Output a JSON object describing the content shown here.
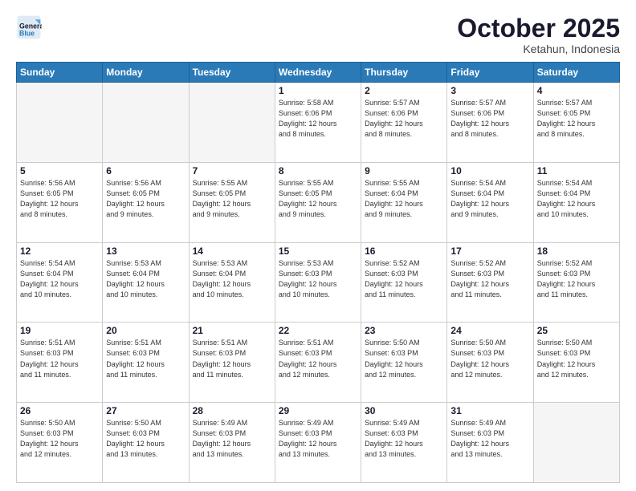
{
  "header": {
    "logo_line1": "General",
    "logo_line2": "Blue",
    "month": "October 2025",
    "location": "Ketahun, Indonesia"
  },
  "weekdays": [
    "Sunday",
    "Monday",
    "Tuesday",
    "Wednesday",
    "Thursday",
    "Friday",
    "Saturday"
  ],
  "weeks": [
    [
      {
        "day": "",
        "info": ""
      },
      {
        "day": "",
        "info": ""
      },
      {
        "day": "",
        "info": ""
      },
      {
        "day": "1",
        "info": "Sunrise: 5:58 AM\nSunset: 6:06 PM\nDaylight: 12 hours\nand 8 minutes."
      },
      {
        "day": "2",
        "info": "Sunrise: 5:57 AM\nSunset: 6:06 PM\nDaylight: 12 hours\nand 8 minutes."
      },
      {
        "day": "3",
        "info": "Sunrise: 5:57 AM\nSunset: 6:06 PM\nDaylight: 12 hours\nand 8 minutes."
      },
      {
        "day": "4",
        "info": "Sunrise: 5:57 AM\nSunset: 6:05 PM\nDaylight: 12 hours\nand 8 minutes."
      }
    ],
    [
      {
        "day": "5",
        "info": "Sunrise: 5:56 AM\nSunset: 6:05 PM\nDaylight: 12 hours\nand 8 minutes."
      },
      {
        "day": "6",
        "info": "Sunrise: 5:56 AM\nSunset: 6:05 PM\nDaylight: 12 hours\nand 9 minutes."
      },
      {
        "day": "7",
        "info": "Sunrise: 5:55 AM\nSunset: 6:05 PM\nDaylight: 12 hours\nand 9 minutes."
      },
      {
        "day": "8",
        "info": "Sunrise: 5:55 AM\nSunset: 6:05 PM\nDaylight: 12 hours\nand 9 minutes."
      },
      {
        "day": "9",
        "info": "Sunrise: 5:55 AM\nSunset: 6:04 PM\nDaylight: 12 hours\nand 9 minutes."
      },
      {
        "day": "10",
        "info": "Sunrise: 5:54 AM\nSunset: 6:04 PM\nDaylight: 12 hours\nand 9 minutes."
      },
      {
        "day": "11",
        "info": "Sunrise: 5:54 AM\nSunset: 6:04 PM\nDaylight: 12 hours\nand 10 minutes."
      }
    ],
    [
      {
        "day": "12",
        "info": "Sunrise: 5:54 AM\nSunset: 6:04 PM\nDaylight: 12 hours\nand 10 minutes."
      },
      {
        "day": "13",
        "info": "Sunrise: 5:53 AM\nSunset: 6:04 PM\nDaylight: 12 hours\nand 10 minutes."
      },
      {
        "day": "14",
        "info": "Sunrise: 5:53 AM\nSunset: 6:04 PM\nDaylight: 12 hours\nand 10 minutes."
      },
      {
        "day": "15",
        "info": "Sunrise: 5:53 AM\nSunset: 6:03 PM\nDaylight: 12 hours\nand 10 minutes."
      },
      {
        "day": "16",
        "info": "Sunrise: 5:52 AM\nSunset: 6:03 PM\nDaylight: 12 hours\nand 11 minutes."
      },
      {
        "day": "17",
        "info": "Sunrise: 5:52 AM\nSunset: 6:03 PM\nDaylight: 12 hours\nand 11 minutes."
      },
      {
        "day": "18",
        "info": "Sunrise: 5:52 AM\nSunset: 6:03 PM\nDaylight: 12 hours\nand 11 minutes."
      }
    ],
    [
      {
        "day": "19",
        "info": "Sunrise: 5:51 AM\nSunset: 6:03 PM\nDaylight: 12 hours\nand 11 minutes."
      },
      {
        "day": "20",
        "info": "Sunrise: 5:51 AM\nSunset: 6:03 PM\nDaylight: 12 hours\nand 11 minutes."
      },
      {
        "day": "21",
        "info": "Sunrise: 5:51 AM\nSunset: 6:03 PM\nDaylight: 12 hours\nand 11 minutes."
      },
      {
        "day": "22",
        "info": "Sunrise: 5:51 AM\nSunset: 6:03 PM\nDaylight: 12 hours\nand 12 minutes."
      },
      {
        "day": "23",
        "info": "Sunrise: 5:50 AM\nSunset: 6:03 PM\nDaylight: 12 hours\nand 12 minutes."
      },
      {
        "day": "24",
        "info": "Sunrise: 5:50 AM\nSunset: 6:03 PM\nDaylight: 12 hours\nand 12 minutes."
      },
      {
        "day": "25",
        "info": "Sunrise: 5:50 AM\nSunset: 6:03 PM\nDaylight: 12 hours\nand 12 minutes."
      }
    ],
    [
      {
        "day": "26",
        "info": "Sunrise: 5:50 AM\nSunset: 6:03 PM\nDaylight: 12 hours\nand 12 minutes."
      },
      {
        "day": "27",
        "info": "Sunrise: 5:50 AM\nSunset: 6:03 PM\nDaylight: 12 hours\nand 13 minutes."
      },
      {
        "day": "28",
        "info": "Sunrise: 5:49 AM\nSunset: 6:03 PM\nDaylight: 12 hours\nand 13 minutes."
      },
      {
        "day": "29",
        "info": "Sunrise: 5:49 AM\nSunset: 6:03 PM\nDaylight: 12 hours\nand 13 minutes."
      },
      {
        "day": "30",
        "info": "Sunrise: 5:49 AM\nSunset: 6:03 PM\nDaylight: 12 hours\nand 13 minutes."
      },
      {
        "day": "31",
        "info": "Sunrise: 5:49 AM\nSunset: 6:03 PM\nDaylight: 12 hours\nand 13 minutes."
      },
      {
        "day": "",
        "info": ""
      }
    ]
  ]
}
